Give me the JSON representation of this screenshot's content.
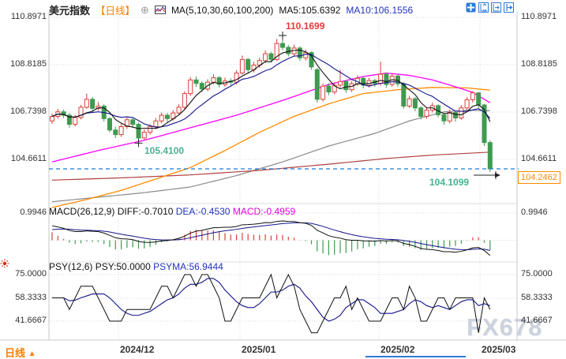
{
  "header": {
    "title": "美元指数",
    "period_tag": "【日线】",
    "add_glyph": "⊕",
    "ma_label": "MA(5,10,30,60,100,200)",
    "ma5_label": "MA5:105.6392",
    "ma10_label": "MA10:106.1556"
  },
  "toolbar": {
    "icons": [
      "crosshair-icon",
      "fit-vertical-icon",
      "zoom-axis-icon",
      "pan-right-icon"
    ]
  },
  "panes": {
    "macd": {
      "title": "MACD(26,12,9)",
      "diff_label": "DIFF:-0.7010",
      "dea_label": "DEA:-0.4530",
      "macd_label": "MACD:-0.4959"
    },
    "psy": {
      "title": "PSY(12,6)",
      "psy_label": "PSY:50.0000",
      "psyma_label": "PSYMA:56.9444"
    }
  },
  "axes": {
    "main": [
      "110.8971",
      "108.8185",
      "106.7398",
      "104.6611"
    ],
    "macd": [
      "0.9946"
    ],
    "psy": [
      "75.0000",
      "58.3333",
      "41.6667"
    ],
    "dates": [
      "2024/12",
      "2025/01",
      "2025/02",
      "2025/03"
    ]
  },
  "annotations": {
    "marked_high": "110.1699",
    "marked_low": "105.4100",
    "session_low": "104.1099",
    "last_price": "104.2462"
  },
  "footer": {
    "period": "日线",
    "triangle": "▲",
    "watermark": "FX678"
  },
  "colors": {
    "up": "#d9403a",
    "down": "#3f9a50",
    "ma5": "#111111",
    "ma10": "#14148c",
    "ma30": "#ff00ff",
    "ma60": "#ff8a00",
    "ma100": "#b04040",
    "ma200": "#8a8a8a",
    "price_line": "#1b7ad2",
    "hist_up": "#d9403a",
    "hist_down": "#3f9a50",
    "macd_diff": "#111111",
    "macd_dea": "#14148c",
    "psy": "#111111",
    "psyma": "#14148c",
    "grid": "#d9d9d9",
    "border": "#c8c8c8",
    "marker": "#222222",
    "sun": "#d42b10"
  },
  "chart_data": {
    "type": "candlestick+indicators",
    "symbol": "美元指数",
    "period": "日线",
    "title": "美元指数 日线",
    "x_axis_labels": [
      "2024/12",
      "2025/01",
      "2025/02",
      "2025/03"
    ],
    "main_axis_values": [
      110.8971,
      108.8185,
      106.7398,
      104.6611
    ],
    "macd_axis_value": 0.9946,
    "psy_axis_values": [
      75.0,
      58.3333,
      41.6667
    ],
    "last_price": 104.2462,
    "marked_high": 110.1699,
    "marked_low": 105.41,
    "session_low": 104.1099,
    "ma5_value": 105.6392,
    "ma10_value": 106.1556,
    "macd_values": {
      "diff": -0.701,
      "dea": -0.453,
      "macd": -0.4959
    },
    "psy_values": {
      "psy": 50.0,
      "psyma": 56.9444
    },
    "candles": [
      [
        106.35,
        106.68,
        106.22,
        106.55
      ],
      [
        106.55,
        106.88,
        106.45,
        106.75
      ],
      [
        106.75,
        106.85,
        106.48,
        106.6
      ],
      [
        106.6,
        106.7,
        106.05,
        106.2
      ],
      [
        106.2,
        106.62,
        106.1,
        106.5
      ],
      [
        106.5,
        107.05,
        106.42,
        106.95
      ],
      [
        106.95,
        107.55,
        106.88,
        107.3
      ],
      [
        107.3,
        107.4,
        106.78,
        106.9
      ],
      [
        106.9,
        107.18,
        106.8,
        107.0
      ],
      [
        107.0,
        107.08,
        106.32,
        106.45
      ],
      [
        106.45,
        106.52,
        105.85,
        105.95
      ],
      [
        105.95,
        106.1,
        105.6,
        105.75
      ],
      [
        105.75,
        106.22,
        105.65,
        106.1
      ],
      [
        106.1,
        106.52,
        106.0,
        106.4
      ],
      [
        106.4,
        106.5,
        106.05,
        106.2
      ],
      [
        106.2,
        106.28,
        105.41,
        105.6
      ],
      [
        105.6,
        105.98,
        105.5,
        105.85
      ],
      [
        105.85,
        106.2,
        105.75,
        106.1
      ],
      [
        106.1,
        106.48,
        106.0,
        106.35
      ],
      [
        106.35,
        106.72,
        106.25,
        106.6
      ],
      [
        106.6,
        106.7,
        106.3,
        106.45
      ],
      [
        106.45,
        106.82,
        106.36,
        106.7
      ],
      [
        106.7,
        107.08,
        106.6,
        106.95
      ],
      [
        106.95,
        107.65,
        106.88,
        107.55
      ],
      [
        107.55,
        108.28,
        107.45,
        108.15
      ],
      [
        108.15,
        108.3,
        107.85,
        108.0
      ],
      [
        108.0,
        108.1,
        107.62,
        107.75
      ],
      [
        107.75,
        108.18,
        107.66,
        108.05
      ],
      [
        108.05,
        108.4,
        107.95,
        108.25
      ],
      [
        108.25,
        108.32,
        107.82,
        107.95
      ],
      [
        107.95,
        108.25,
        107.85,
        108.1
      ],
      [
        108.1,
        108.22,
        107.92,
        108.05
      ],
      [
        108.05,
        108.58,
        107.95,
        108.45
      ],
      [
        108.45,
        109.22,
        108.38,
        109.05
      ],
      [
        109.05,
        109.12,
        108.45,
        108.6
      ],
      [
        108.6,
        108.95,
        108.48,
        108.8
      ],
      [
        108.8,
        109.12,
        108.68,
        109.0
      ],
      [
        109.0,
        109.45,
        108.9,
        109.3
      ],
      [
        109.3,
        109.38,
        108.92,
        109.05
      ],
      [
        109.05,
        109.95,
        108.98,
        109.75
      ],
      [
        109.75,
        110.1699,
        109.45,
        109.58
      ],
      [
        109.58,
        109.68,
        109.18,
        109.3
      ],
      [
        109.3,
        109.7,
        109.2,
        109.55
      ],
      [
        109.55,
        109.62,
        108.98,
        109.12
      ],
      [
        109.12,
        109.48,
        109.0,
        109.35
      ],
      [
        109.35,
        109.4,
        108.6,
        108.72
      ],
      [
        108.6,
        108.68,
        107.15,
        107.3
      ],
      [
        107.3,
        108.0,
        107.2,
        107.88
      ],
      [
        107.88,
        108.0,
        107.48,
        107.62
      ],
      [
        107.62,
        108.05,
        107.52,
        107.92
      ],
      [
        107.92,
        108.6,
        107.82,
        108.08
      ],
      [
        108.08,
        108.15,
        107.58,
        107.72
      ],
      [
        107.72,
        108.1,
        107.62,
        107.98
      ],
      [
        107.98,
        108.35,
        107.88,
        108.22
      ],
      [
        108.22,
        108.3,
        107.78,
        107.92
      ],
      [
        107.92,
        108.25,
        107.82,
        108.12
      ],
      [
        108.12,
        108.2,
        107.85,
        108.0
      ],
      [
        108.0,
        108.95,
        107.9,
        108.4
      ],
      [
        108.4,
        108.48,
        107.8,
        107.95
      ],
      [
        107.95,
        108.45,
        107.85,
        108.32
      ],
      [
        108.32,
        108.4,
        107.85,
        107.98
      ],
      [
        107.98,
        108.05,
        106.88,
        107.0
      ],
      [
        107.0,
        107.45,
        106.92,
        107.32
      ],
      [
        107.32,
        107.4,
        106.78,
        106.92
      ],
      [
        106.92,
        107.0,
        106.42,
        106.55
      ],
      [
        106.55,
        106.95,
        106.45,
        106.82
      ],
      [
        106.82,
        107.15,
        106.72,
        107.02
      ],
      [
        107.02,
        107.08,
        106.5,
        106.62
      ],
      [
        106.62,
        106.7,
        106.18,
        106.35
      ],
      [
        106.35,
        106.85,
        106.25,
        106.72
      ],
      [
        106.72,
        106.8,
        106.32,
        106.48
      ],
      [
        106.48,
        107.05,
        106.4,
        106.92
      ],
      [
        106.92,
        107.4,
        106.82,
        107.28
      ],
      [
        107.28,
        107.66,
        107.15,
        107.58
      ],
      [
        107.58,
        107.62,
        106.9,
        107.05
      ],
      [
        107.05,
        107.1,
        105.25,
        105.4
      ],
      [
        105.4,
        105.5,
        104.1099,
        104.2462
      ]
    ],
    "ma_windows": {
      "ma5": 5,
      "ma10": 10
    },
    "ma_control_points": {
      "ma30": [
        [
          0,
          104.55
        ],
        [
          8,
          105.05
        ],
        [
          16,
          105.5
        ],
        [
          24,
          106.05
        ],
        [
          32,
          106.6
        ],
        [
          40,
          107.25
        ],
        [
          48,
          107.95
        ],
        [
          54,
          108.3
        ],
        [
          58,
          108.45
        ],
        [
          62,
          108.35
        ],
        [
          66,
          108.15
        ],
        [
          70,
          107.85
        ],
        [
          73,
          107.6
        ],
        [
          76,
          107.15
        ]
      ],
      "ma60": [
        [
          0,
          102.55
        ],
        [
          6,
          102.9
        ],
        [
          12,
          103.3
        ],
        [
          18,
          103.8
        ],
        [
          24,
          104.3
        ],
        [
          30,
          105.05
        ],
        [
          36,
          105.85
        ],
        [
          42,
          106.55
        ],
        [
          48,
          107.1
        ],
        [
          54,
          107.55
        ],
        [
          60,
          107.72
        ],
        [
          66,
          107.82
        ],
        [
          72,
          107.8
        ],
        [
          76,
          107.7
        ]
      ],
      "ma100": [
        [
          0,
          103.75
        ],
        [
          12,
          103.85
        ],
        [
          24,
          103.98
        ],
        [
          36,
          104.18
        ],
        [
          48,
          104.45
        ],
        [
          58,
          104.7
        ],
        [
          66,
          104.85
        ],
        [
          76,
          104.98
        ]
      ],
      "ma200": [
        [
          0,
          102.8
        ],
        [
          8,
          103.0
        ],
        [
          16,
          103.2
        ],
        [
          24,
          103.45
        ],
        [
          32,
          103.95
        ],
        [
          40,
          104.55
        ],
        [
          48,
          105.25
        ],
        [
          56,
          105.8
        ],
        [
          62,
          106.35
        ],
        [
          68,
          106.75
        ],
        [
          72,
          106.82
        ],
        [
          76,
          106.8
        ]
      ]
    },
    "macd_seed": {
      "ema12": 106.85,
      "ema26": 106.25,
      "dea": 0.35
    },
    "psy": [
      58.33,
      58.33,
      58.33,
      50,
      58.33,
      66.67,
      66.67,
      66.67,
      58.33,
      50,
      41.67,
      41.67,
      41.67,
      50,
      50,
      50,
      50,
      50,
      58.33,
      66.67,
      66.67,
      58.33,
      66.67,
      75,
      75,
      66.67,
      75,
      75,
      66.67,
      58.33,
      41.67,
      41.67,
      50,
      58.33,
      58.33,
      58.33,
      58.33,
      66.67,
      75,
      58.33,
      66.67,
      75,
      66.67,
      50,
      41.67,
      33.33,
      33.33,
      41.67,
      50,
      58.33,
      58.33,
      66.67,
      50,
      58.33,
      50,
      41.67,
      41.67,
      41.67,
      50,
      58.33,
      58.33,
      50,
      66.67,
      58.33,
      41.67,
      41.67,
      50,
      58.33,
      58.33,
      50,
      58.33,
      58.33,
      58.33,
      58.33,
      33.33,
      58.33,
      50
    ],
    "psy_window": 6
  }
}
